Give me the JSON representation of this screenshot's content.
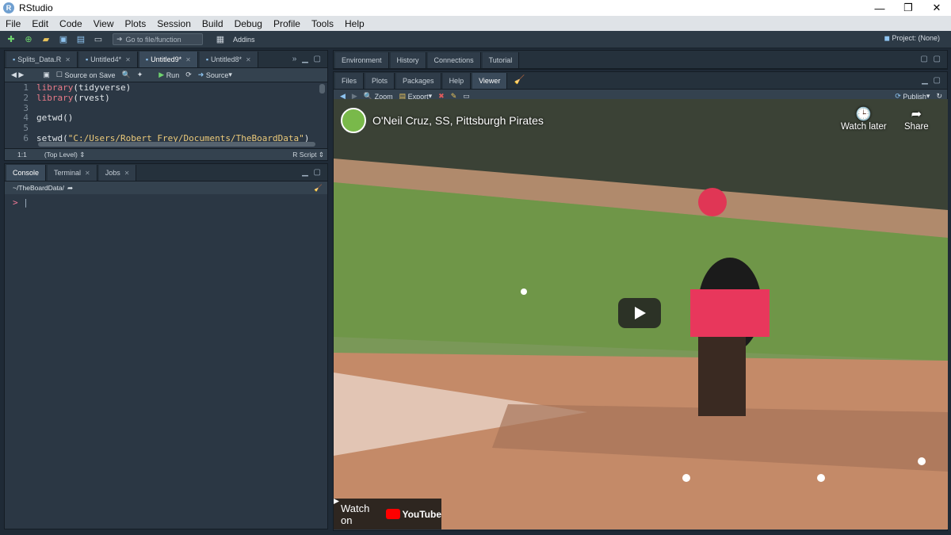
{
  "window": {
    "title": "RStudio",
    "min": "—",
    "max": "❐",
    "close": "✕"
  },
  "menu": [
    "File",
    "Edit",
    "Code",
    "View",
    "Plots",
    "Session",
    "Build",
    "Debug",
    "Profile",
    "Tools",
    "Help"
  ],
  "toolbar": {
    "goto_placeholder": "Go to file/function",
    "addins": "Addins",
    "project": "Project: (None)"
  },
  "editor": {
    "tabs": [
      {
        "label": "Splits_Data.R",
        "active": false
      },
      {
        "label": "Untitled4*",
        "active": false
      },
      {
        "label": "Untitled9*",
        "active": true
      },
      {
        "label": "Untitled8*",
        "active": false
      }
    ],
    "source_on_save": "Source on Save",
    "run": "Run",
    "source": "Source",
    "lines": [
      {
        "n": "1",
        "fn": "library",
        "arg": "(tidyverse)"
      },
      {
        "n": "2",
        "fn": "library",
        "arg": "(rvest)"
      },
      {
        "n": "3",
        "fn": "",
        "arg": ""
      },
      {
        "n": "4",
        "fn": "getwd",
        "arg": "()"
      },
      {
        "n": "5",
        "fn": "",
        "arg": ""
      },
      {
        "n": "6",
        "fn": "setwd",
        "arg": "(",
        "str": "\"C:/Users/Robert Frey/Documents/TheBoardData\"",
        "end": ")"
      }
    ],
    "status_pos": "1:1",
    "status_scope": "(Top Level)",
    "status_type": "R Script"
  },
  "console": {
    "tabs": [
      "Console",
      "Terminal",
      "Jobs"
    ],
    "path": "~/TheBoardData/",
    "prompt": ">"
  },
  "env_pane": {
    "tabs": [
      "Environment",
      "History",
      "Connections",
      "Tutorial"
    ]
  },
  "files_pane": {
    "tabs": [
      "Files",
      "Plots",
      "Packages",
      "Help",
      "Viewer"
    ],
    "active": "Viewer",
    "zoom": "Zoom",
    "export": "Export",
    "publish": "Publish"
  },
  "video": {
    "title": "O'Neil Cruz, SS, Pittsburgh Pirates",
    "watch_later": "Watch later",
    "share": "Share",
    "watch_on": "Watch on",
    "youtube": "YouTube"
  },
  "colors": {
    "accent": "#f00",
    "editor_bg": "#2b3744",
    "string": "#ecca7a",
    "keyword": "#e97b88"
  }
}
